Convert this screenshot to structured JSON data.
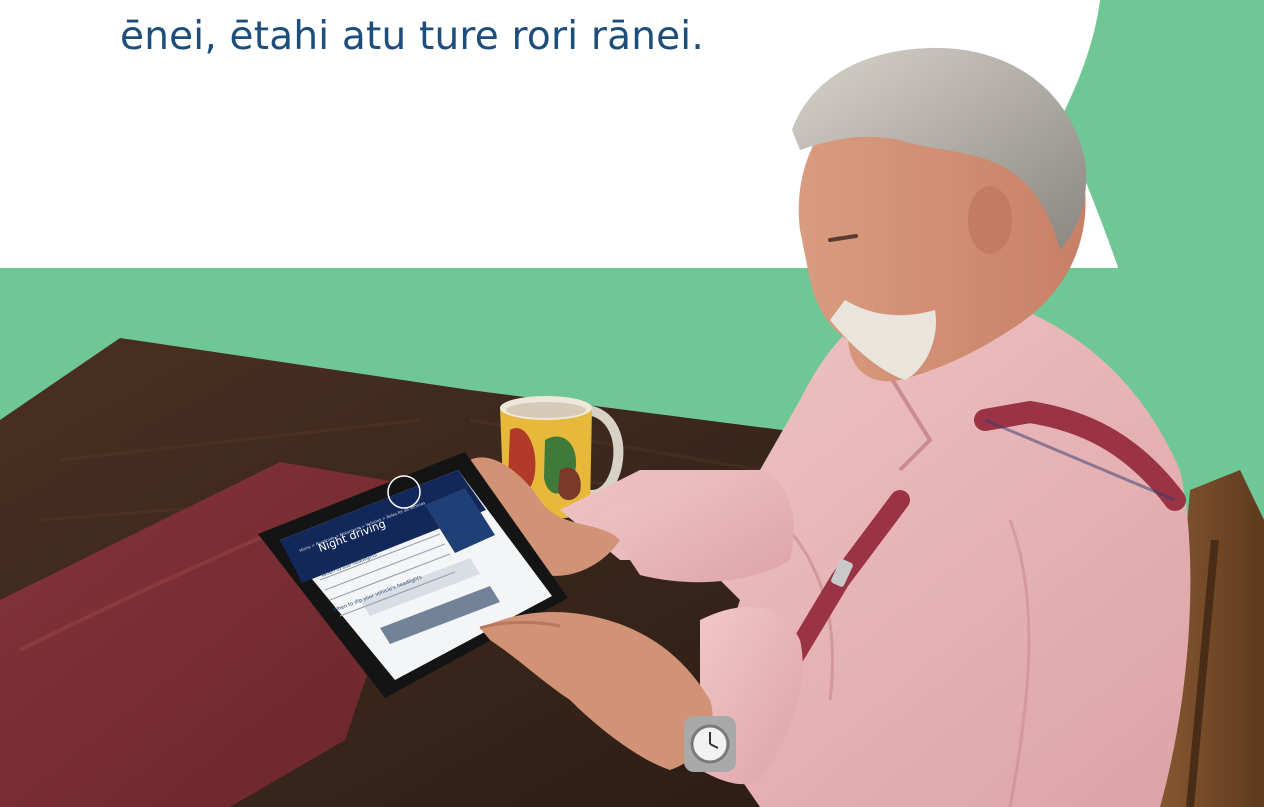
{
  "intro": {
    "text": "ēnei, ētahi atu ture rori rānei."
  },
  "tablet_page": {
    "breadcrumb": "Home > Roadcode > Motorcycle > Vehicles > Rules for all vehicles",
    "title": "Night driving",
    "heading_1": "When to use headlights",
    "heading_2": "When to dip your vehicle's headlights"
  },
  "colors": {
    "accent_green": "#6fc795",
    "text_blue": "#1d4d7a",
    "tablet_header": "#13285a",
    "sidebar_blue": "#1f3f76",
    "table_wood": "#3f2a1e",
    "runner_red": "#7a2d31",
    "shirt_pink": "#eab7b8",
    "braces_red": "#9a3444"
  }
}
